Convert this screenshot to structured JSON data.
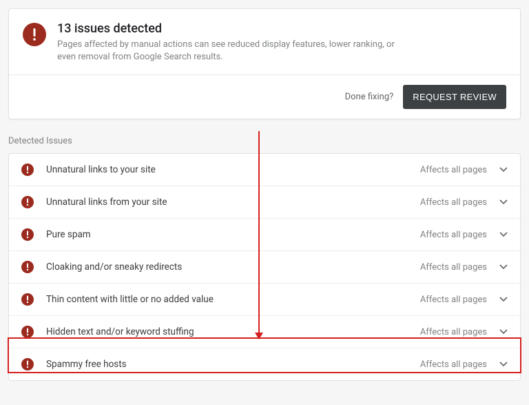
{
  "header": {
    "title": "13 issues detected",
    "description": "Pages affected by manual actions can see reduced display features, lower ranking, or even removal from Google Search results.",
    "done_label": "Done fixing?",
    "request_label": "REQUEST REVIEW"
  },
  "section_label": "Detected Issues",
  "affects_label": "Affects all pages",
  "issues": [
    {
      "title": "Unnatural links to your site"
    },
    {
      "title": "Unnatural links from your site"
    },
    {
      "title": "Pure spam"
    },
    {
      "title": "Cloaking and/or sneaky redirects"
    },
    {
      "title": "Thin content with little or no added value"
    },
    {
      "title": "Hidden text and/or keyword stuffing"
    },
    {
      "title": "Spammy free hosts"
    }
  ]
}
